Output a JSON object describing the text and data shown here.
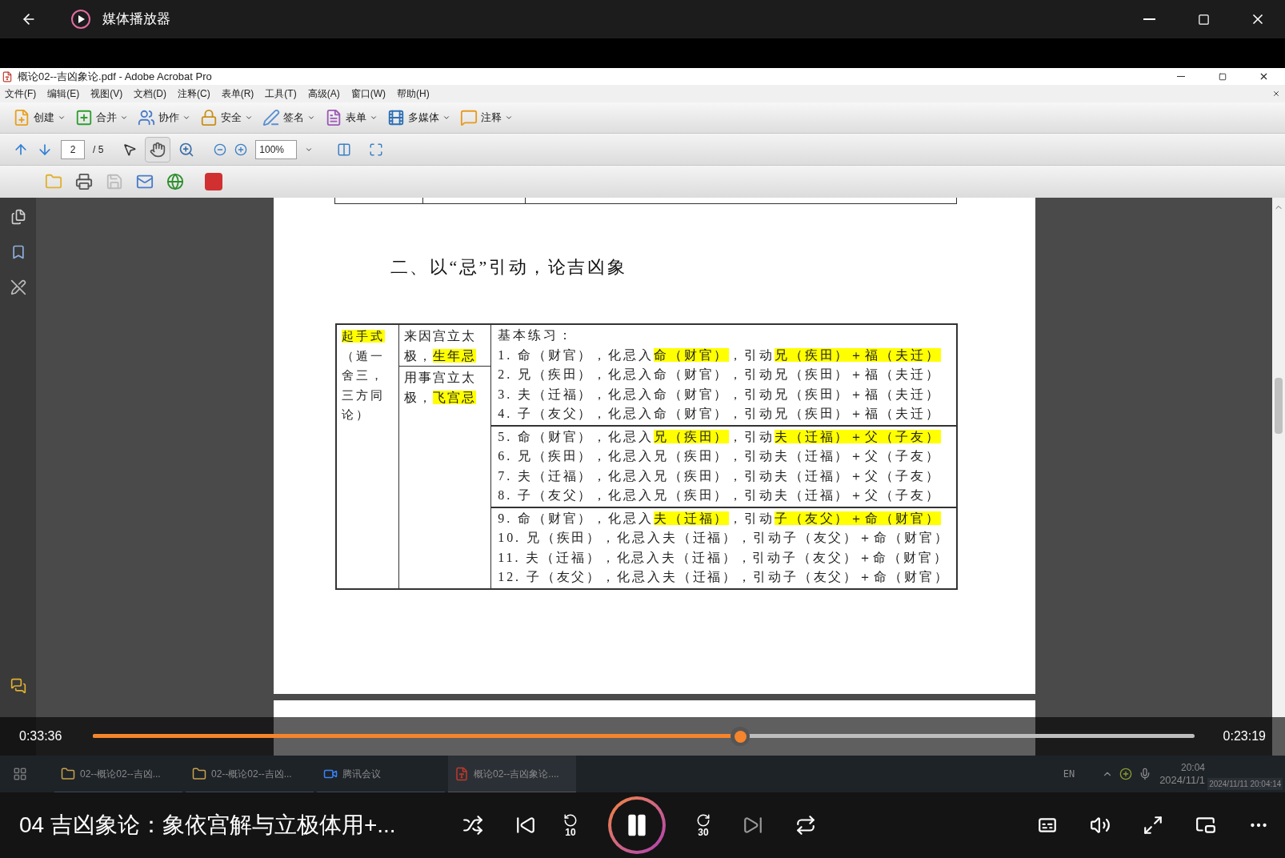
{
  "window": {
    "title": "媒体播放器"
  },
  "acrobat": {
    "title": "概论02--吉凶象论.pdf - Adobe Acrobat Pro",
    "menu": [
      "文件(F)",
      "编辑(E)",
      "视图(V)",
      "文档(D)",
      "注释(C)",
      "表单(R)",
      "工具(T)",
      "高级(A)",
      "窗口(W)",
      "帮助(H)"
    ],
    "tasks": [
      {
        "kind": "create",
        "label": "创建"
      },
      {
        "kind": "combine",
        "label": "合并"
      },
      {
        "kind": "collaborate",
        "label": "协作"
      },
      {
        "kind": "secure",
        "label": "安全"
      },
      {
        "kind": "sign",
        "label": "签名"
      },
      {
        "kind": "forms",
        "label": "表单"
      },
      {
        "kind": "multimedia",
        "label": "多媒体"
      },
      {
        "kind": "comment",
        "label": "注释"
      }
    ],
    "page_number": "2",
    "page_count": "/ 5",
    "zoom": "100%",
    "hand_tool_selected": true,
    "document": {
      "heading": "二、以“忌”引动，论吉凶象",
      "col1": {
        "highlight": "起手式",
        "text": "（遁一舍三，三方同论）"
      },
      "col2": [
        {
          "text": "来因宫立太极，",
          "highlight": "生年忌"
        },
        {
          "text": "用事宫立太极，",
          "highlight": "飞宫忌"
        }
      ],
      "exercise_title": "基本练习：",
      "groups": [
        [
          [
            {
              "t": "1. 命（财官），化忌入",
              "hl": false
            },
            {
              "t": "命（财官）",
              "hl": true
            },
            {
              "t": "，引动",
              "hl": false
            },
            {
              "t": "兄（疾田）＋福（夫迁）",
              "hl": true
            }
          ],
          [
            {
              "t": "2. 兄（疾田），化忌入命（财官），引动兄（疾田）＋福（夫迁）",
              "hl": false
            }
          ],
          [
            {
              "t": "3. 夫（迁福），化忌入命（财官），引动兄（疾田）＋福（夫迁）",
              "hl": false
            }
          ],
          [
            {
              "t": "4. 子（友父），化忌入命（财官），引动兄（疾田）＋福（夫迁）",
              "hl": false
            }
          ]
        ],
        [
          [
            {
              "t": "5. 命（财官），化忌入",
              "hl": false
            },
            {
              "t": "兄（疾田）",
              "hl": true
            },
            {
              "t": "，引动",
              "hl": false
            },
            {
              "t": "夫（迁福）＋父（子友）",
              "hl": true
            }
          ],
          [
            {
              "t": "6. 兄（疾田），化忌入兄（疾田），引动夫（迁福）＋父（子友）",
              "hl": false
            }
          ],
          [
            {
              "t": "7. 夫（迁福），化忌入兄（疾田），引动夫（迁福）＋父（子友）",
              "hl": false
            }
          ],
          [
            {
              "t": "8. 子（友父），化忌入兄（疾田），引动夫（迁福）＋父（子友）",
              "hl": false
            }
          ]
        ],
        [
          [
            {
              "t": "9. 命（财官），化忌入",
              "hl": false
            },
            {
              "t": "夫（迁福）",
              "hl": true
            },
            {
              "t": "，引动",
              "hl": false
            },
            {
              "t": "子（友父）＋命（财官）",
              "hl": true
            }
          ],
          [
            {
              "t": "10. 兄（疾田），化忌入夫（迁福），引动子（友父）＋命（财官）",
              "hl": false
            }
          ],
          [
            {
              "t": "11. 夫（迁福），化忌入夫（迁福），引动子（友父）＋命（财官）",
              "hl": false
            }
          ],
          [
            {
              "t": "12. 子（友父），化忌入夫（迁福），引动子（友父）＋命（财官）",
              "hl": false
            }
          ]
        ]
      ]
    }
  },
  "recorded_taskbar": {
    "items": [
      {
        "kind": "folder",
        "label": "02--概论02--吉凶...",
        "selected": false
      },
      {
        "kind": "folder",
        "label": "02--概论02--吉凶...",
        "selected": false
      },
      {
        "kind": "meeting",
        "label": "腾讯会议",
        "selected": false
      },
      {
        "kind": "pdf",
        "label": "概论02--吉凶象论....",
        "selected": true
      }
    ],
    "language": "EN",
    "time": "20:04",
    "date": "2024/11/1",
    "tooltip": "2024/11/11 20:04:14"
  },
  "player": {
    "elapsed": "0:33:36",
    "remaining": "0:23:19",
    "level": 0.588,
    "now_playing": "04 吉凶象论：象依宫解与立极体用+...",
    "playing": true,
    "rewind_label": "10",
    "forward_label": "30"
  }
}
